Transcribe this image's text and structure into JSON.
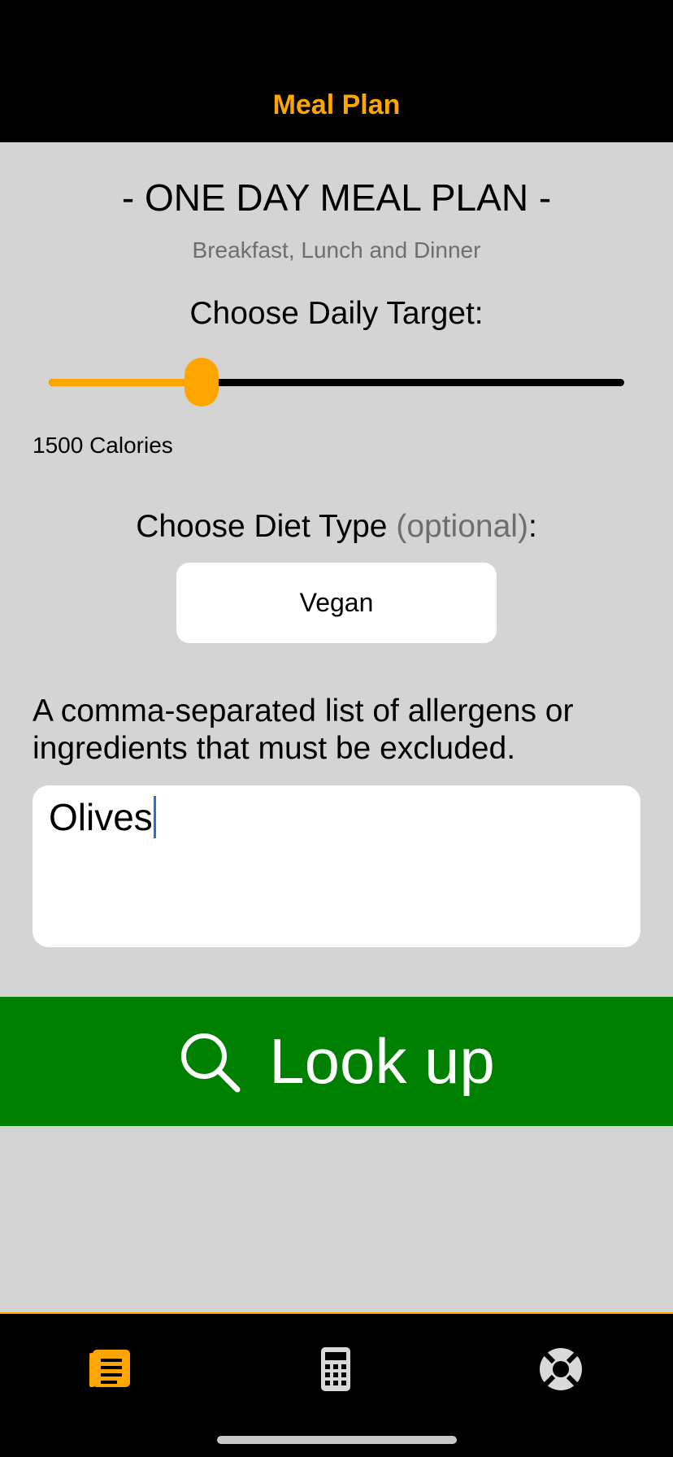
{
  "header": {
    "title": "Meal Plan"
  },
  "main": {
    "title": "- ONE DAY MEAL PLAN -",
    "subtitle": "Breakfast, Lunch and Dinner",
    "target_label": "Choose Daily Target:",
    "slider": {
      "fraction": 0.265
    },
    "calories_text": "1500 Calories",
    "diet_label": "Choose Diet Type",
    "diet_label_optional": "(optional)",
    "diet_label_colon": ":",
    "diet_value": "Vegan",
    "exclude_label": "A comma-separated list of allergens or ingredients that must be excluded.",
    "exclude_value": "Olives",
    "lookup_label": "Look up"
  },
  "tabs": [
    {
      "icon": "list-icon",
      "active": true
    },
    {
      "icon": "calculator-icon",
      "active": false
    },
    {
      "icon": "lifebuoy-icon",
      "active": false
    }
  ],
  "colors": {
    "accent": "#ffa500",
    "button_green": "#008000",
    "background": "#d4d4d4",
    "inactive_icon": "#d9d9d9"
  }
}
